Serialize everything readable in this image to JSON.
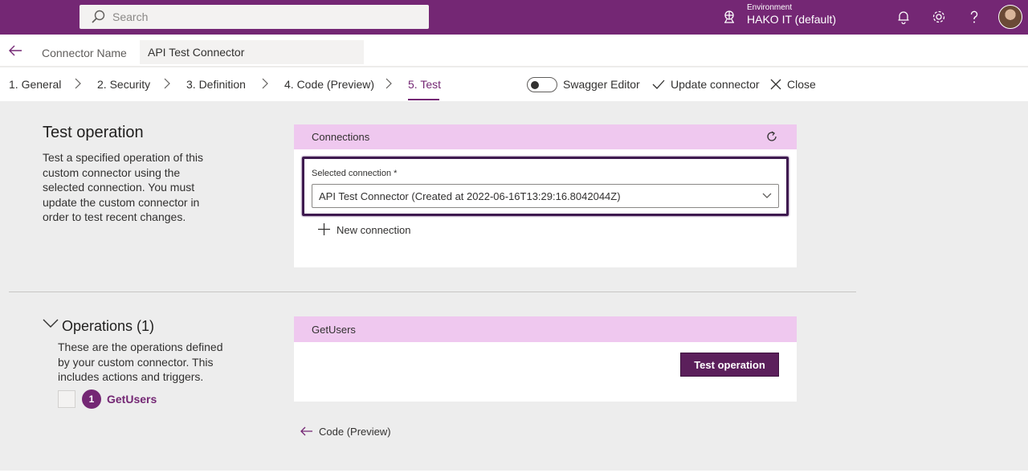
{
  "topbar": {
    "search_placeholder": "Search",
    "environment_label": "Environment",
    "environment_value": "HAKO IT (default)",
    "icons": [
      "environment-icon",
      "bell-icon",
      "gear-icon",
      "help-icon",
      "avatar"
    ]
  },
  "connector": {
    "name_label": "Connector Name",
    "name_value": "API Test Connector"
  },
  "steps": [
    {
      "label": "1. General"
    },
    {
      "label": "2. Security"
    },
    {
      "label": "3. Definition"
    },
    {
      "label": "4. Code (Preview)"
    },
    {
      "label": "5. Test",
      "active": true
    }
  ],
  "actions": {
    "swagger_label": "Swagger Editor",
    "swagger_on": false,
    "update_label": "Update connector",
    "close_label": "Close"
  },
  "test_section": {
    "title": "Test operation",
    "description": "Test a specified operation of this custom connector using the selected connection. You must update the custom connector in order to test recent changes."
  },
  "connections": {
    "header": "Connections",
    "selected_label": "Selected connection *",
    "selected_value": "API Test Connector (Created at 2022-06-16T13:29:16.8042044Z)",
    "new_connection_label": "New connection"
  },
  "operations": {
    "title": "Operations (1)",
    "description": "These are the operations defined by your custom connector. This includes actions and triggers.",
    "items": [
      {
        "number": "1",
        "name": "GetUsers"
      }
    ],
    "card_header": "GetUsers",
    "test_button_label": "Test operation"
  },
  "footer": {
    "back_label": "Code (Preview)"
  },
  "colors": {
    "brand": "#742774",
    "card_header": "#efc8ef",
    "button": "#5b1f5b"
  }
}
